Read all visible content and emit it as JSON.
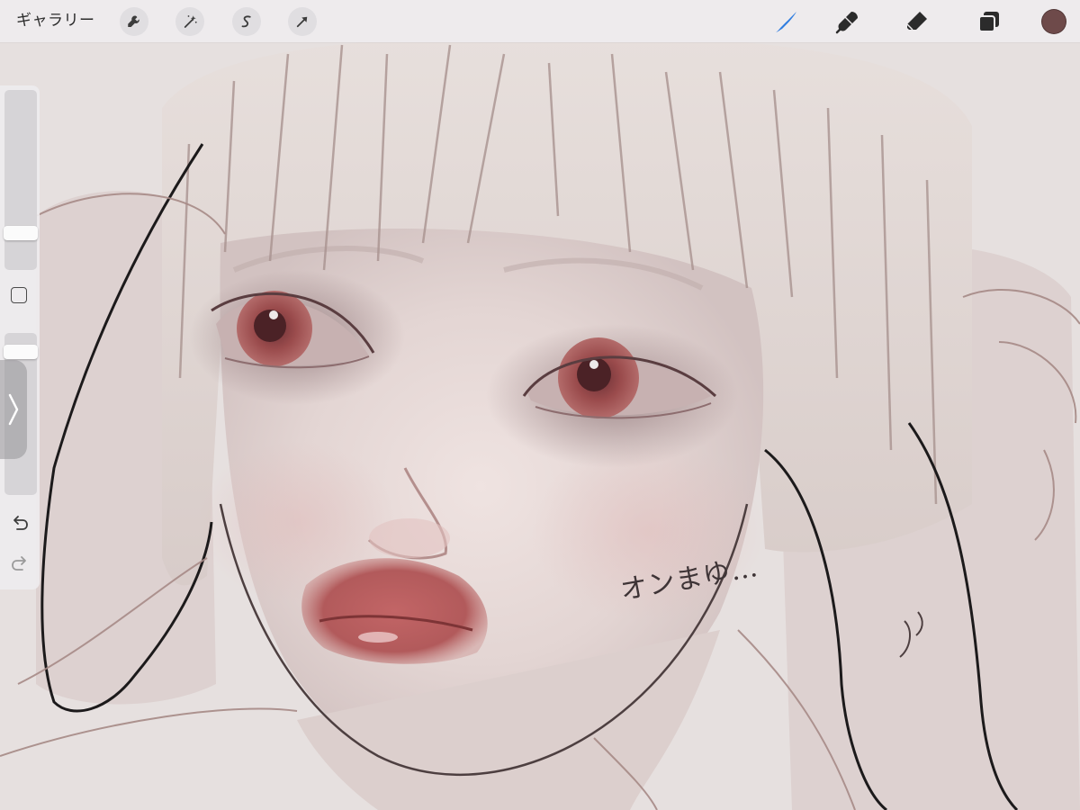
{
  "toolbar": {
    "gallery_label": "ギャラリー",
    "left_tools": [
      {
        "icon": "wrench-icon",
        "name": "actions-button"
      },
      {
        "icon": "magic-wand-icon",
        "name": "adjustments-button"
      },
      {
        "icon": "selection-s-icon",
        "name": "selection-button"
      },
      {
        "icon": "arrow-cursor-icon",
        "name": "transform-button"
      }
    ],
    "right_tools": [
      {
        "icon": "brush-icon",
        "name": "paint-tool",
        "active": true
      },
      {
        "icon": "smudge-icon",
        "name": "smudge-tool"
      },
      {
        "icon": "eraser-icon",
        "name": "eraser-tool"
      },
      {
        "icon": "layers-icon",
        "name": "layers-button"
      }
    ],
    "current_color": "#6e4a4a",
    "active_tool_color": "#2f7de0"
  },
  "sidebar": {
    "brush_size": 0.18,
    "opacity": 0.92,
    "undo_icon": "undo-icon",
    "redo_icon": "redo-icon",
    "toggle_icon": "chevron-right-icon"
  },
  "canvas": {
    "handwritten_note": "オンまゆ…",
    "background_color": "#e6e0df"
  }
}
